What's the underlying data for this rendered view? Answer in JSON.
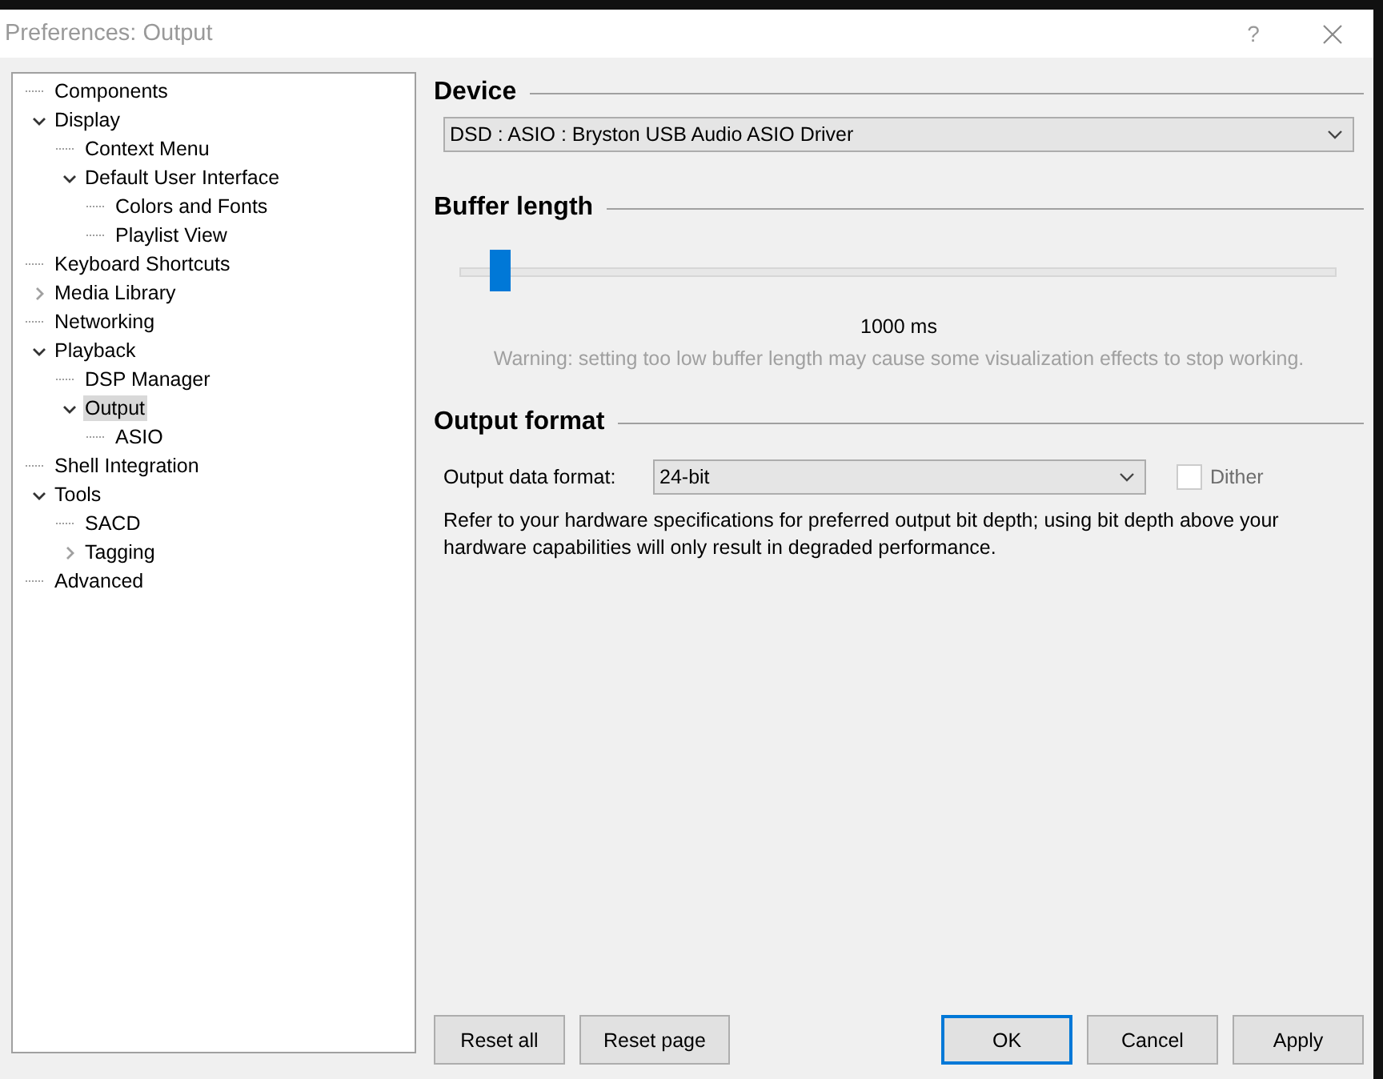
{
  "window": {
    "title": "Preferences: Output",
    "help": "?"
  },
  "tree": [
    {
      "label": "Components",
      "selected": false
    },
    {
      "label": "Display",
      "selected": false,
      "expanded": true,
      "children": [
        {
          "label": "Context Menu",
          "selected": false
        },
        {
          "label": "Default User Interface",
          "selected": false,
          "expanded": true,
          "children": [
            {
              "label": "Colors and Fonts",
              "selected": false
            },
            {
              "label": "Playlist View",
              "selected": false
            }
          ]
        }
      ]
    },
    {
      "label": "Keyboard Shortcuts",
      "selected": false
    },
    {
      "label": "Media Library",
      "selected": false,
      "expanded": false
    },
    {
      "label": "Networking",
      "selected": false
    },
    {
      "label": "Playback",
      "selected": false,
      "expanded": true,
      "children": [
        {
          "label": "DSP Manager",
          "selected": false
        },
        {
          "label": "Output",
          "selected": true,
          "expanded": true,
          "children": [
            {
              "label": "ASIO",
              "selected": false
            }
          ]
        }
      ]
    },
    {
      "label": "Shell Integration",
      "selected": false
    },
    {
      "label": "Tools",
      "selected": false,
      "expanded": true,
      "children": [
        {
          "label": "SACD",
          "selected": false
        },
        {
          "label": "Tagging",
          "selected": false,
          "expanded": false
        }
      ]
    },
    {
      "label": "Advanced",
      "selected": false
    }
  ],
  "device": {
    "heading": "Device",
    "value": "DSD : ASIO : Bryston USB Audio ASIO Driver"
  },
  "buffer": {
    "heading": "Buffer length",
    "level": 0.045,
    "reading": "1000 ms",
    "warning": "Warning: setting too low buffer length may cause some visualization effects to stop working."
  },
  "output_format": {
    "heading": "Output format",
    "label": "Output data format:",
    "value": "24-bit",
    "dither": {
      "label": "Dither",
      "checked": false,
      "disabled": true
    },
    "note": "Refer to your hardware specifications for preferred output bit depth; using bit depth above your hardware capabilities will only result in degraded performance."
  },
  "buttons": [
    {
      "label": "Reset all",
      "kind": "left"
    },
    {
      "label": "Reset page",
      "kind": "left"
    },
    {
      "label": "OK",
      "kind": "default"
    },
    {
      "label": "Cancel",
      "kind": "right"
    },
    {
      "label": "Apply",
      "kind": "right"
    }
  ]
}
